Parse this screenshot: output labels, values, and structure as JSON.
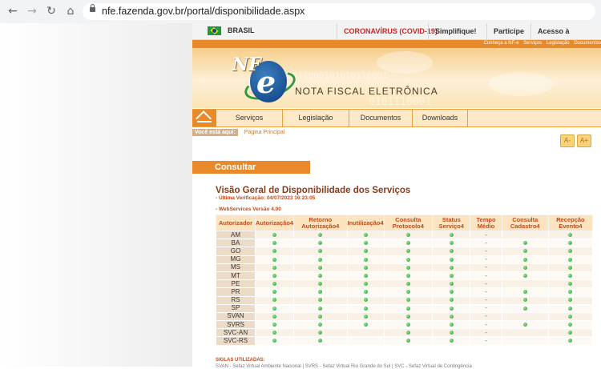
{
  "browser": {
    "url": "nfe.fazenda.gov.br/portal/disponibilidade.aspx",
    "back_icon": "←",
    "forward_icon": "→",
    "reload_icon": "↻",
    "home_icon": "⌂"
  },
  "gov_bar": {
    "country": "BRASIL",
    "links": [
      "CORONAVÍRUS (COVID-19)",
      "Simplifique!",
      "Participe",
      "Acesso à informação"
    ]
  },
  "banner": {
    "top_links": [
      "Conheça a NF-e",
      "Serviços",
      "Legislação",
      "Documentos"
    ],
    "logo_nf": "NF",
    "logo_e": "e",
    "title": "NOTA FISCAL ELETRÔNICA",
    "binary_1": "0011000101010110001",
    "binary_2": "0101110001"
  },
  "main_nav": {
    "items": [
      "Serviços",
      "Legislação",
      "Documentos",
      "Downloads"
    ]
  },
  "breadcrumb": {
    "label": "Você está aqui:",
    "link": "Página Principal"
  },
  "font_controls": {
    "decrease": "A-",
    "increase": "A+"
  },
  "section_title": "Consultar Disponibilidade",
  "heading": "Visão Geral de Disponibilidade dos Serviços",
  "last_check": "- Última Verificação: 04/07/2023 16:23:05",
  "ws_version": "- WebServices Versão 4.00",
  "table": {
    "headers": [
      "Autorizador",
      "Autorização4",
      "Retorno Autorização4",
      "Inutilização4",
      "Consulta Protocolo4",
      "Status Serviço4",
      "Tempo Médio",
      "Consulta Cadastro4",
      "Recepção Evento4"
    ],
    "rows": [
      {
        "aut": "AM",
        "cells": [
          "ok",
          "ok",
          "ok",
          "ok",
          "ok",
          "-",
          "",
          "ok"
        ]
      },
      {
        "aut": "BA",
        "cells": [
          "ok",
          "ok",
          "ok",
          "ok",
          "ok",
          "-",
          "ok",
          "ok"
        ]
      },
      {
        "aut": "GO",
        "cells": [
          "ok",
          "ok",
          "ok",
          "ok",
          "ok",
          "-",
          "ok",
          "ok"
        ]
      },
      {
        "aut": "MG",
        "cells": [
          "ok",
          "ok",
          "ok",
          "ok",
          "ok",
          "-",
          "ok",
          "ok"
        ]
      },
      {
        "aut": "MS",
        "cells": [
          "ok",
          "ok",
          "ok",
          "ok",
          "ok",
          "-",
          "ok",
          "ok"
        ]
      },
      {
        "aut": "MT",
        "cells": [
          "ok",
          "ok",
          "ok",
          "ok",
          "ok",
          "-",
          "ok",
          "ok"
        ]
      },
      {
        "aut": "PE",
        "cells": [
          "ok",
          "ok",
          "ok",
          "ok",
          "ok",
          "-",
          "",
          "ok"
        ]
      },
      {
        "aut": "PR",
        "cells": [
          "ok",
          "ok",
          "ok",
          "ok",
          "ok",
          "-",
          "ok",
          "ok"
        ]
      },
      {
        "aut": "RS",
        "cells": [
          "ok",
          "ok",
          "ok",
          "ok",
          "ok",
          "-",
          "ok",
          "ok"
        ]
      },
      {
        "aut": "SP",
        "cells": [
          "ok",
          "ok",
          "ok",
          "ok",
          "ok",
          "-",
          "ok",
          "ok"
        ]
      },
      {
        "aut": "SVAN",
        "cells": [
          "ok",
          "ok",
          "ok",
          "ok",
          "ok",
          "-",
          "",
          "ok"
        ]
      },
      {
        "aut": "SVRS",
        "cells": [
          "ok",
          "ok",
          "ok",
          "ok",
          "ok",
          "-",
          "ok",
          "ok"
        ]
      },
      {
        "aut": "SVC-AN",
        "cells": [
          "ok",
          "ok",
          "",
          "ok",
          "ok",
          "-",
          "",
          "ok"
        ]
      },
      {
        "aut": "SVC-RS",
        "cells": [
          "ok",
          "ok",
          "",
          "ok",
          "ok",
          "-",
          "",
          "ok"
        ]
      }
    ]
  },
  "siglas_title": "SIGLAS UTILIZADAS:",
  "siglas_text": "SVAN - Sefaz Virtual Ambiente Nacional | SVRS - Sefaz Virtual Rio Grande do Sul | SVC - Sefaz Virtual de Contingência",
  "colors": {
    "accent_orange": "#e88a2a",
    "status_green": "#1b9a32",
    "heading_brown": "#8b3a1a"
  }
}
